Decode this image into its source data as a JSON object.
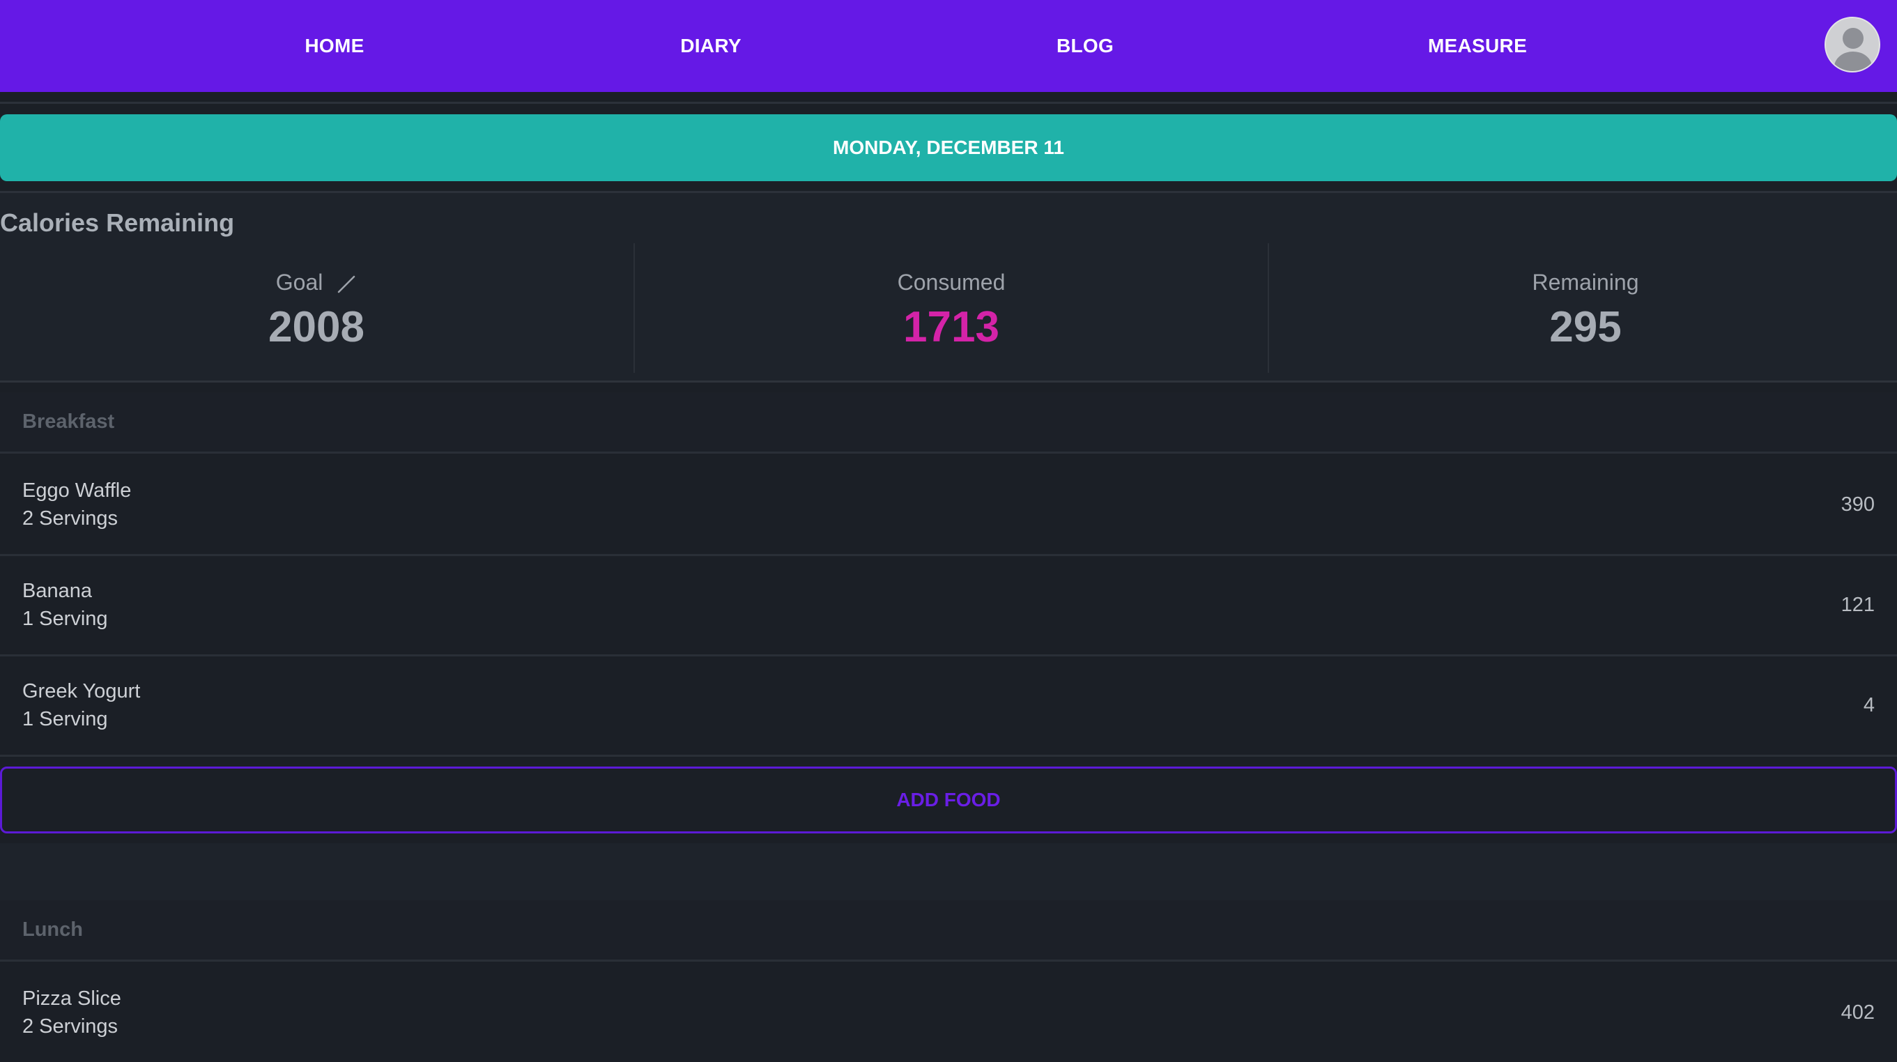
{
  "nav": {
    "links": [
      "HOME",
      "DIARY",
      "BLOG",
      "MEASURE"
    ]
  },
  "date_label": "MONDAY, DECEMBER 11",
  "summary": {
    "title": "Calories Remaining",
    "goal": {
      "label": "Goal",
      "value": "2008"
    },
    "consumed": {
      "label": "Consumed",
      "value": "1713"
    },
    "remaining": {
      "label": "Remaining",
      "value": "295"
    }
  },
  "meals": {
    "breakfast": {
      "title": "Breakfast",
      "items": [
        {
          "name": "Eggo Waffle",
          "serving": "2 Servings",
          "calories": "390"
        },
        {
          "name": "Banana",
          "serving": "1 Serving",
          "calories": "121"
        },
        {
          "name": "Greek Yogurt",
          "serving": "1 Serving",
          "calories": "4"
        }
      ],
      "add_label": "ADD FOOD"
    },
    "lunch": {
      "title": "Lunch",
      "items": [
        {
          "name": "Pizza Slice",
          "serving": "2 Servings",
          "calories": "402"
        }
      ]
    }
  },
  "colors": {
    "nav_bg": "#6519e6",
    "date_bar": "#20b2a9",
    "consumed": "#d423a8",
    "add_food_accent": "#6a1ee6",
    "page_bg": "#1b1f26"
  },
  "icons": [
    "pencil-icon",
    "user-avatar-icon"
  ]
}
